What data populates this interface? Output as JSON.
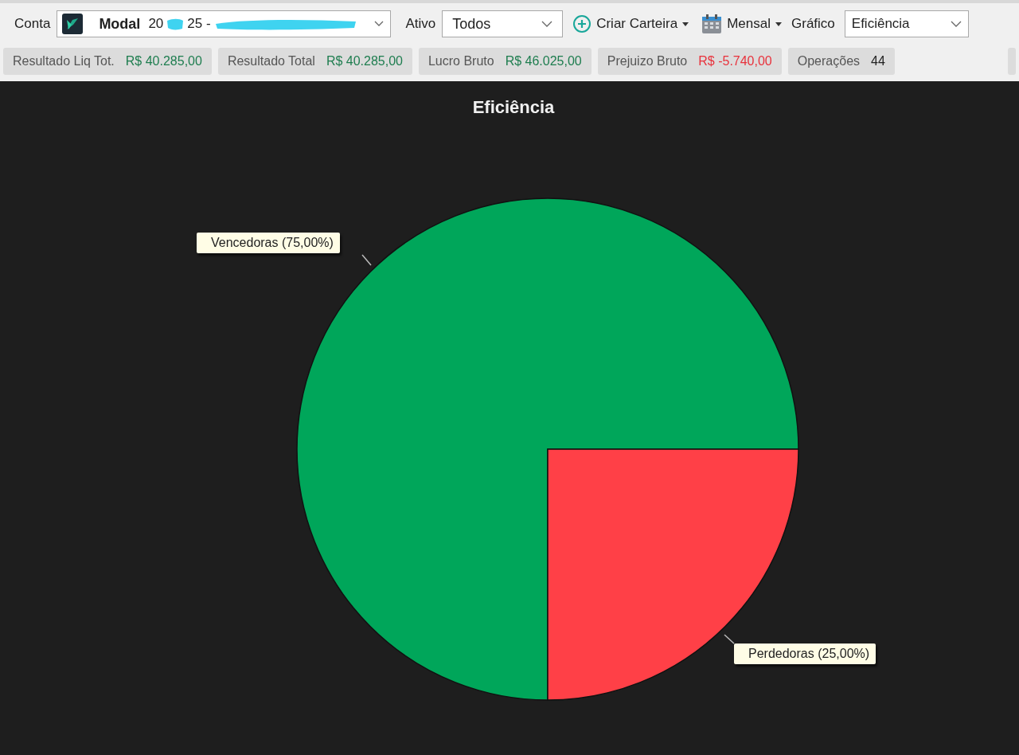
{
  "toolbar": {
    "account_label": "Conta",
    "account": {
      "name": "Modal",
      "number_start": "20",
      "number_end": "25 -"
    },
    "asset_label": "Ativo",
    "asset_value": "Todos",
    "create_wallet": "Criar Carteira",
    "period": "Mensal",
    "chart_label": "Gráfico",
    "chart_value": "Eficiência"
  },
  "stats": [
    {
      "label": "Resultado Liq Tot.",
      "value": "R$ 40.285,00",
      "color": "#1e7d4f"
    },
    {
      "label": "Resultado Total",
      "value": "R$ 40.285,00",
      "color": "#1e7d4f"
    },
    {
      "label": "Lucro Bruto",
      "value": "R$ 46.025,00",
      "color": "#1e7d4f"
    },
    {
      "label": "Prejuizo Bruto",
      "value": "R$ -5.740,00",
      "color": "#e8323c"
    },
    {
      "label": "Operações",
      "value": "44",
      "color": "#222222"
    }
  ],
  "chart": {
    "chart_data": {
      "type": "pie",
      "title": "Eficiência",
      "values": [
        75,
        25
      ],
      "value_labels": [
        "Vencedoras (75,00%)",
        "Perdedoras (25,00%)"
      ]
    }
  }
}
